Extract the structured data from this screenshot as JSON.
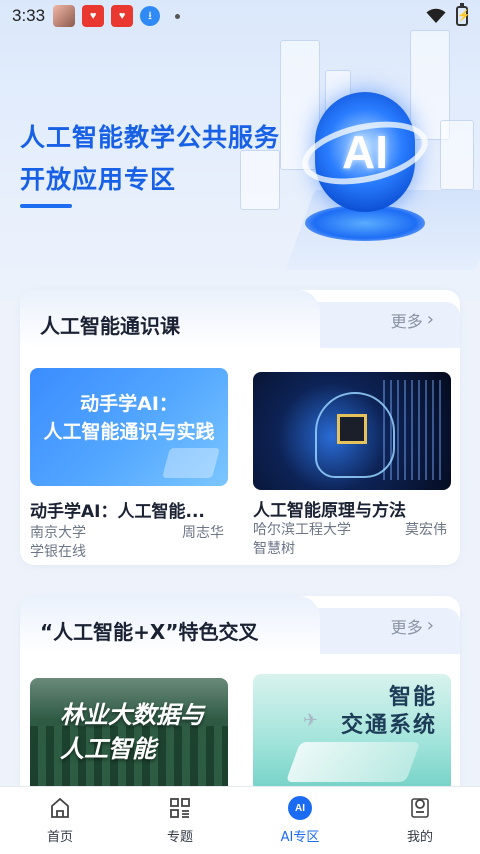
{
  "status_bar": {
    "time": "3:33"
  },
  "hero": {
    "title_line1": "人工智能教学公共服务",
    "title_line2": "开放应用专区",
    "orb_label": "AI"
  },
  "section1": {
    "title": "人工智能通识课",
    "more": "更多",
    "courses": [
      {
        "thumb_text_line1": "动手学AI：",
        "thumb_text_line2": "人工智能通识与实践",
        "title": "动手学AI：人工智能...",
        "school": "南京大学",
        "teacher": "周志华",
        "platform": "学银在线"
      },
      {
        "title": "人工智能原理与方法",
        "school": "哈尔滨工程大学",
        "teacher": "莫宏伟",
        "platform": "智慧树"
      }
    ]
  },
  "section2": {
    "title": "“人工智能+X”特色交叉",
    "more": "更多",
    "cards": [
      {
        "thumb_text_line1": "林业大数据与",
        "thumb_text_line2": "人工智能"
      },
      {
        "thumb_text_line1": "智能",
        "thumb_text_line2": "交通系统"
      }
    ]
  },
  "bottom_nav": [
    {
      "label": "首页",
      "icon": "home-icon"
    },
    {
      "label": "专题",
      "icon": "grid-icon"
    },
    {
      "label": "AI专区",
      "icon": "ai-icon",
      "badge": "AI",
      "active": true
    },
    {
      "label": "我的",
      "icon": "profile-icon"
    }
  ],
  "colors": {
    "accent": "#1b6cf2",
    "hero_title": "#1861e6"
  }
}
